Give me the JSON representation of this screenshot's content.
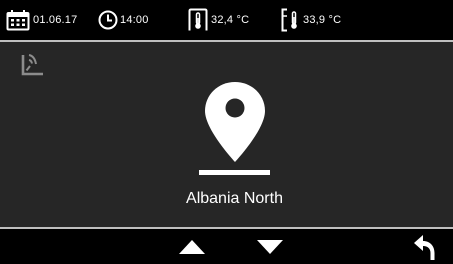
{
  "status_bar": {
    "date": "01.06.17",
    "time": "14:00",
    "indoor_temp": "32,4 °C",
    "outdoor_temp": "33,9 °C",
    "icons": [
      "calendar-icon",
      "clock-icon",
      "indoor-thermometer-icon",
      "outdoor-thermometer-icon"
    ]
  },
  "main": {
    "signal_icon": "antenna-signal-icon",
    "location_icon": "map-pin-icon",
    "location_name": "Albania North"
  },
  "bottom_bar": {
    "buttons": [
      "up-arrow-button",
      "down-arrow-button",
      "back-button"
    ]
  },
  "colors": {
    "background": "#262626",
    "bar": "#000000",
    "divider": "#bfbfbf",
    "foreground": "#ffffff"
  }
}
